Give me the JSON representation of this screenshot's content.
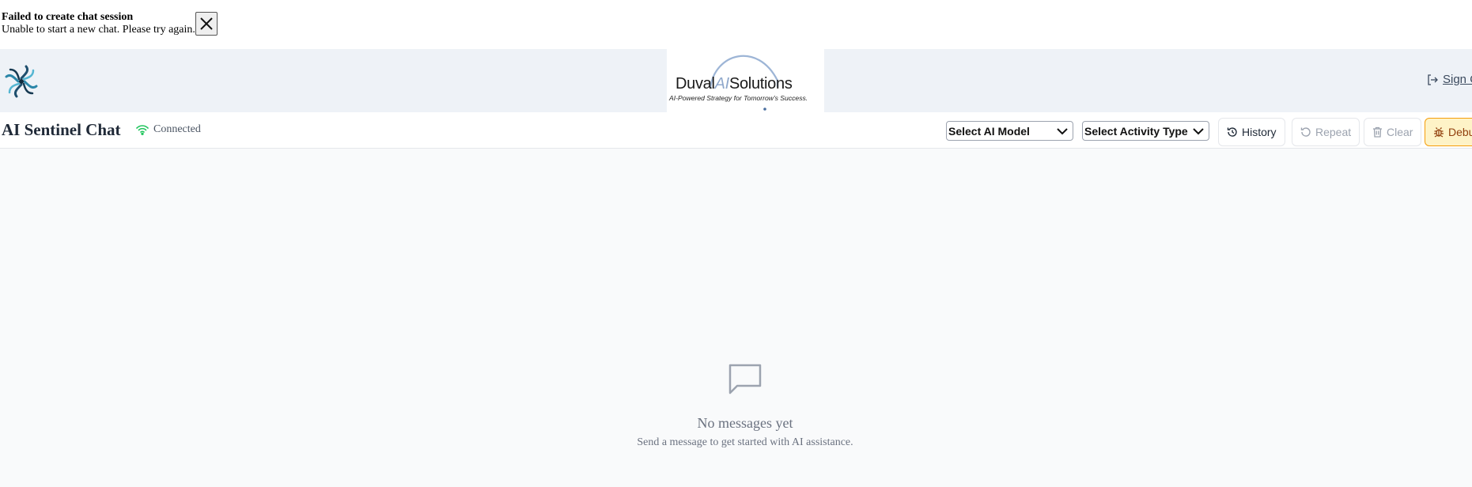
{
  "toast": {
    "title": "Failed to create chat session",
    "message": "Unable to start a new chat. Please try again.",
    "close_icon": "close-icon"
  },
  "header": {
    "app_logo_icon": "swirl-logo-icon",
    "brand_prefix": "Duval",
    "brand_ai": "AI",
    "brand_suffix": "Solutions",
    "brand_tagline": "AI-Powered Strategy for Tomorrow's Success.",
    "signout_label": "Sign Out",
    "signout_icon": "sign-out-icon"
  },
  "chat": {
    "title": "AI Sentinel Chat",
    "status": "Connected",
    "status_icon": "wifi-icon",
    "model_select": "Select AI Model",
    "activity_select": "Select Activity Type",
    "history_label": "History",
    "repeat_label": "Repeat",
    "clear_label": "Clear",
    "debug_label": "Debug"
  },
  "empty": {
    "title": "No messages yet",
    "subtitle": "Send a message to get started with AI assistance.",
    "icon": "message-square-icon"
  },
  "colors": {
    "header_bg": "#eef2f7",
    "main_bg": "#f9fafb",
    "status_green": "#22c55e",
    "debug_bg": "#fef3c7",
    "debug_border": "#f59e0b",
    "brand_accent": "#8fa8cc"
  }
}
